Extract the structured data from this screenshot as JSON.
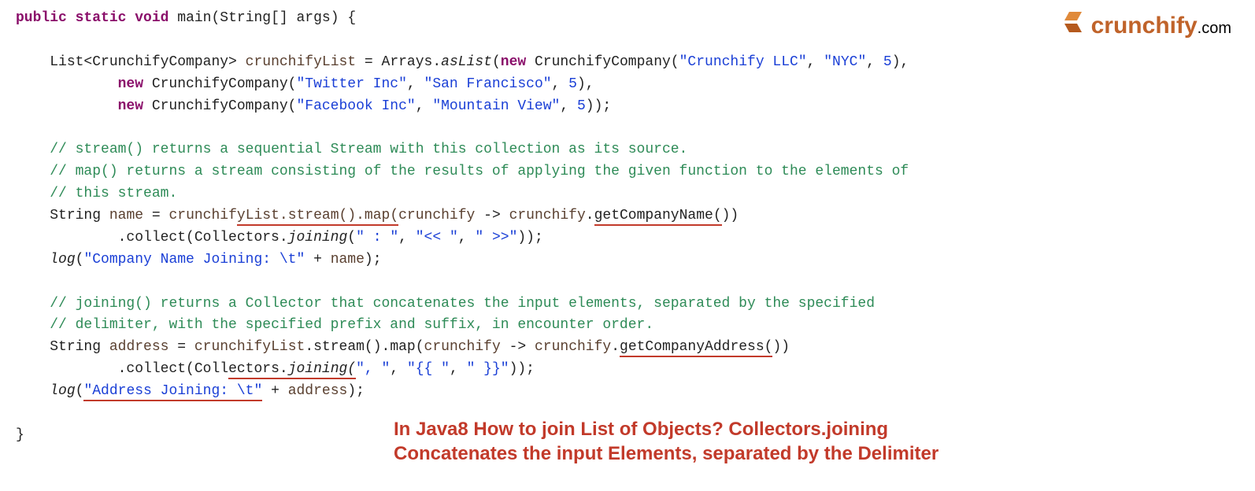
{
  "logo": {
    "brand": "crunchify",
    "suffix": ".com"
  },
  "caption": {
    "line1": "In Java8 How to join List of Objects? Collectors.joining",
    "line2": "Concatenates the input Elements, separated by the Delimiter"
  },
  "code": {
    "sig_public": "public",
    "sig_static": "static",
    "sig_void": "void",
    "sig_main": "main(String[] args) {",
    "l1a": "List<CrunchifyCompany> ",
    "l1_var": "crunchifyList",
    "l1b": " = Arrays.",
    "l1_asList": "asList",
    "l1c": "(",
    "kw_new": "new",
    "l1_comp1": " CrunchifyCompany(",
    "l1_str1": "\"Crunchify LLC\"",
    "l1_str2": "\"NYC\"",
    "l1_num": "5",
    "l1_end": "),",
    "l2_comp": " CrunchifyCompany(",
    "l2_str1": "\"Twitter Inc\"",
    "l2_str2": "\"San Francisco\"",
    "l2_end": "),",
    "l3_comp": " CrunchifyCompany(",
    "l3_str1": "\"Facebook Inc\"",
    "l3_str2": "\"Mountain View\"",
    "l3_end": "));",
    "c1": "// stream() returns a sequential Stream with this collection as its source.",
    "c2": "// map() returns a stream consisting of the results of applying the given function to the elements of",
    "c3": "// this stream.",
    "n1a": "String ",
    "n1_name": "name",
    "n1b": " = ",
    "n1_var": "crunchif",
    "n1_ul": "yList.stream().map(",
    "n1c": "crunchify",
    "n1d": " -> ",
    "n1e": "crunchify",
    "n1f": ".",
    "n1_ul2": "getCompanyName(",
    "n1g": "))",
    "col1a": ".collect(Collectors.",
    "col1_join": "joining",
    "col1b": "(",
    "col1_s1": "\" : \"",
    "col1_s2": "\"<< \"",
    "col1_s3": "\" >>\"",
    "col1c": "));",
    "log1a": "log",
    "log1b": "(",
    "log1_str": "\"Company Name Joining: \\t\"",
    "log1c": " + ",
    "log1_var": "name",
    "log1d": ");",
    "c4": "// joining() returns a Collector that concatenates the input elements, separated by the specified",
    "c5": "// delimiter, with the specified prefix and suffix, in encounter order.",
    "a1a": "String ",
    "a1_name": "address",
    "a1b": " = ",
    "a1_var": "crunchifyList",
    "a1c": ".stream().map(",
    "a1d": "crunchify",
    "a1e": " -> ",
    "a1f": "crunchify",
    "a1g": ".",
    "a1_ul": "getCompanyAddress(",
    "a1h": "))",
    "col2a": ".collect(Coll",
    "col2_ul": "ectors.",
    "col2_join": "joining(",
    "col2_s1": "\", \"",
    "col2_s2": "\"{{ \"",
    "col2_s3": "\" }}\"",
    "col2c": "));",
    "log2a": "log",
    "log2b": "(",
    "log2_str": "\"Address Joining: \\t\"",
    "log2c": " + ",
    "log2_var": "address",
    "log2d": ");",
    "closebrace": "}"
  }
}
